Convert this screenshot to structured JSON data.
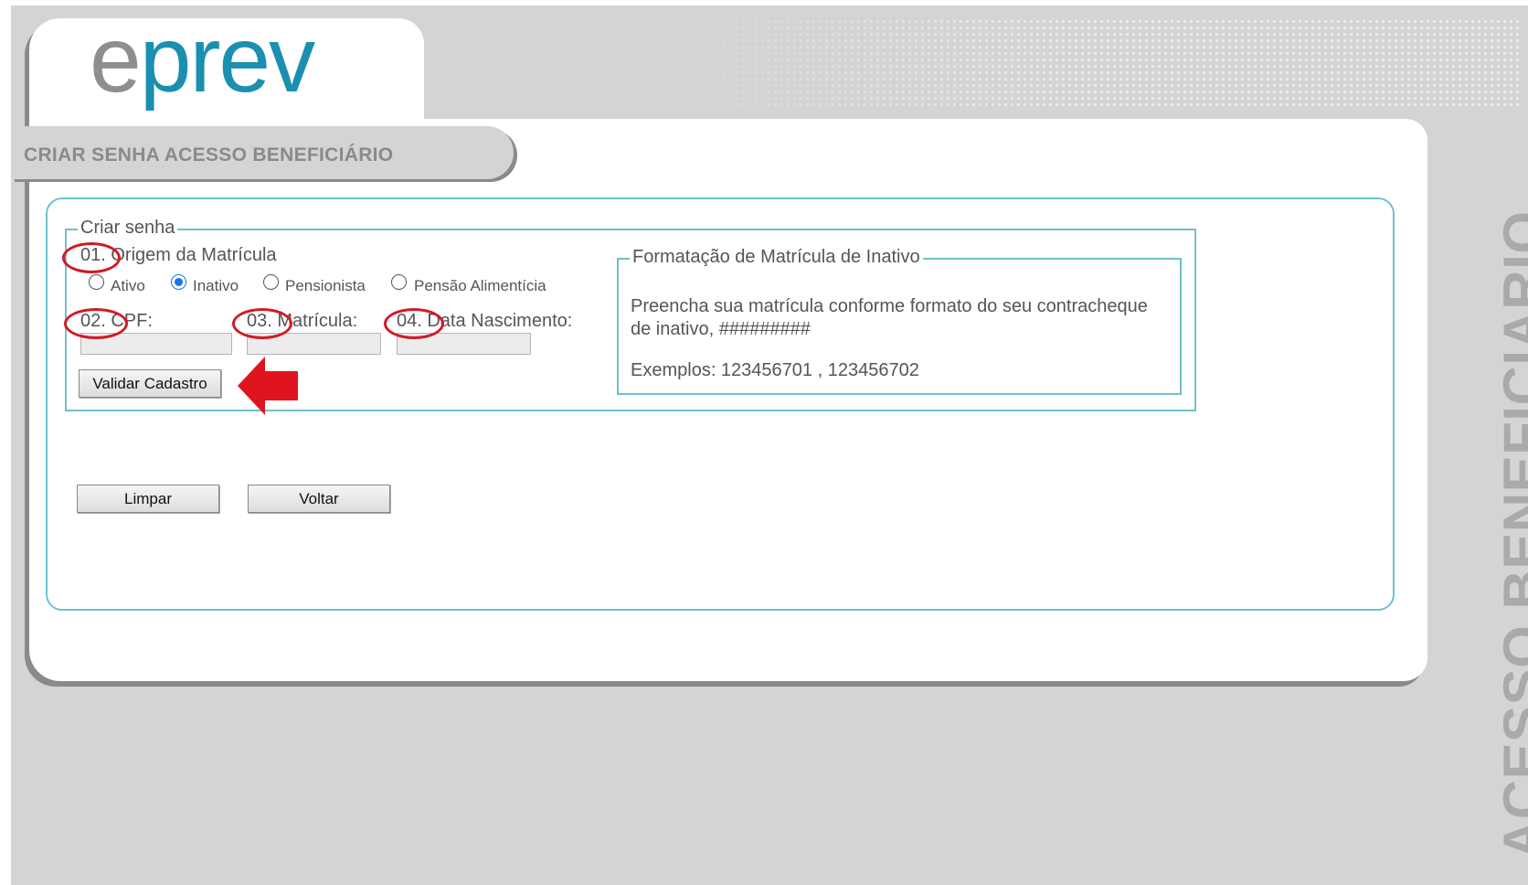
{
  "header": {
    "logo_text": "eprev",
    "page_title": "CRIAR SENHA ACESSO BENEFICIÁRIO",
    "side_title": "ACESSO BENEFICIARIO"
  },
  "form": {
    "legend": "Criar senha",
    "origem_label": "01. Origem da Matrícula",
    "options": [
      {
        "label": "Ativo",
        "selected": false
      },
      {
        "label": "Inativo",
        "selected": true
      },
      {
        "label": "Pensionista",
        "selected": false
      },
      {
        "label": "Pensão Alimentícia",
        "selected": false
      }
    ],
    "cpf_label": "02. CPF:",
    "matricula_label": "03. Matrícula:",
    "nascimento_label": "04. Data Nascimento:",
    "cpf_value": "",
    "matricula_value": "",
    "nascimento_value": "",
    "validar_label": "Validar Cadastro"
  },
  "info": {
    "legend": "Formatação de Matrícula de Inativo",
    "text_line1": "Preencha sua matrícula conforme formato do seu contracheque",
    "text_line2": "de inativo, #########",
    "examples": "Exemplos: 123456701 , 123456702"
  },
  "actions": {
    "limpar_label": "Limpar",
    "voltar_label": "Voltar"
  },
  "annotations": {
    "circle_color": "#d11a24",
    "arrow_color": "#e0141e"
  },
  "colors": {
    "brand_blue": "#1a8fb0",
    "border_teal": "#6fc2cf",
    "background_gray": "#d4d4d4"
  }
}
